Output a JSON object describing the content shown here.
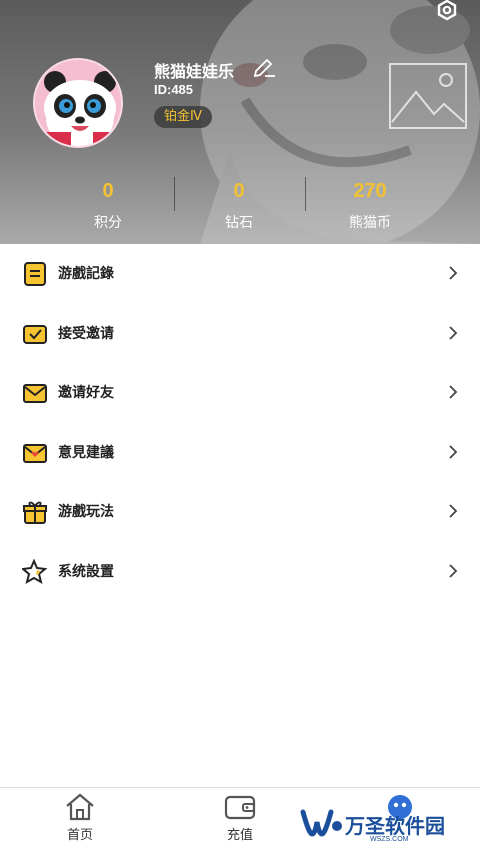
{
  "profile": {
    "username": "熊猫娃娃乐",
    "id_label": "ID:485",
    "level": "铂金Ⅳ"
  },
  "stats": [
    {
      "value": "0",
      "label": "积分"
    },
    {
      "value": "0",
      "label": "钻石"
    },
    {
      "value": "270",
      "label": "熊猫币"
    }
  ],
  "menu": [
    {
      "label": "游戲記錄",
      "icon": "list-icon"
    },
    {
      "label": "接受邀请",
      "icon": "mail-check-icon"
    },
    {
      "label": "邀请好友",
      "icon": "envelope-icon"
    },
    {
      "label": "意見建議",
      "icon": "envelope-heart-icon"
    },
    {
      "label": "游戲玩法",
      "icon": "gift-icon"
    },
    {
      "label": "系统設置",
      "icon": "star-settings-icon"
    }
  ],
  "nav": {
    "home": "首页",
    "recharge": "充值"
  },
  "watermark": {
    "text": "万圣软件园",
    "sub": "WSZS.COM"
  },
  "colors": {
    "accent": "#f2c233",
    "header_bg": "#6e6e6e",
    "watermark": "#1b4f9c"
  }
}
